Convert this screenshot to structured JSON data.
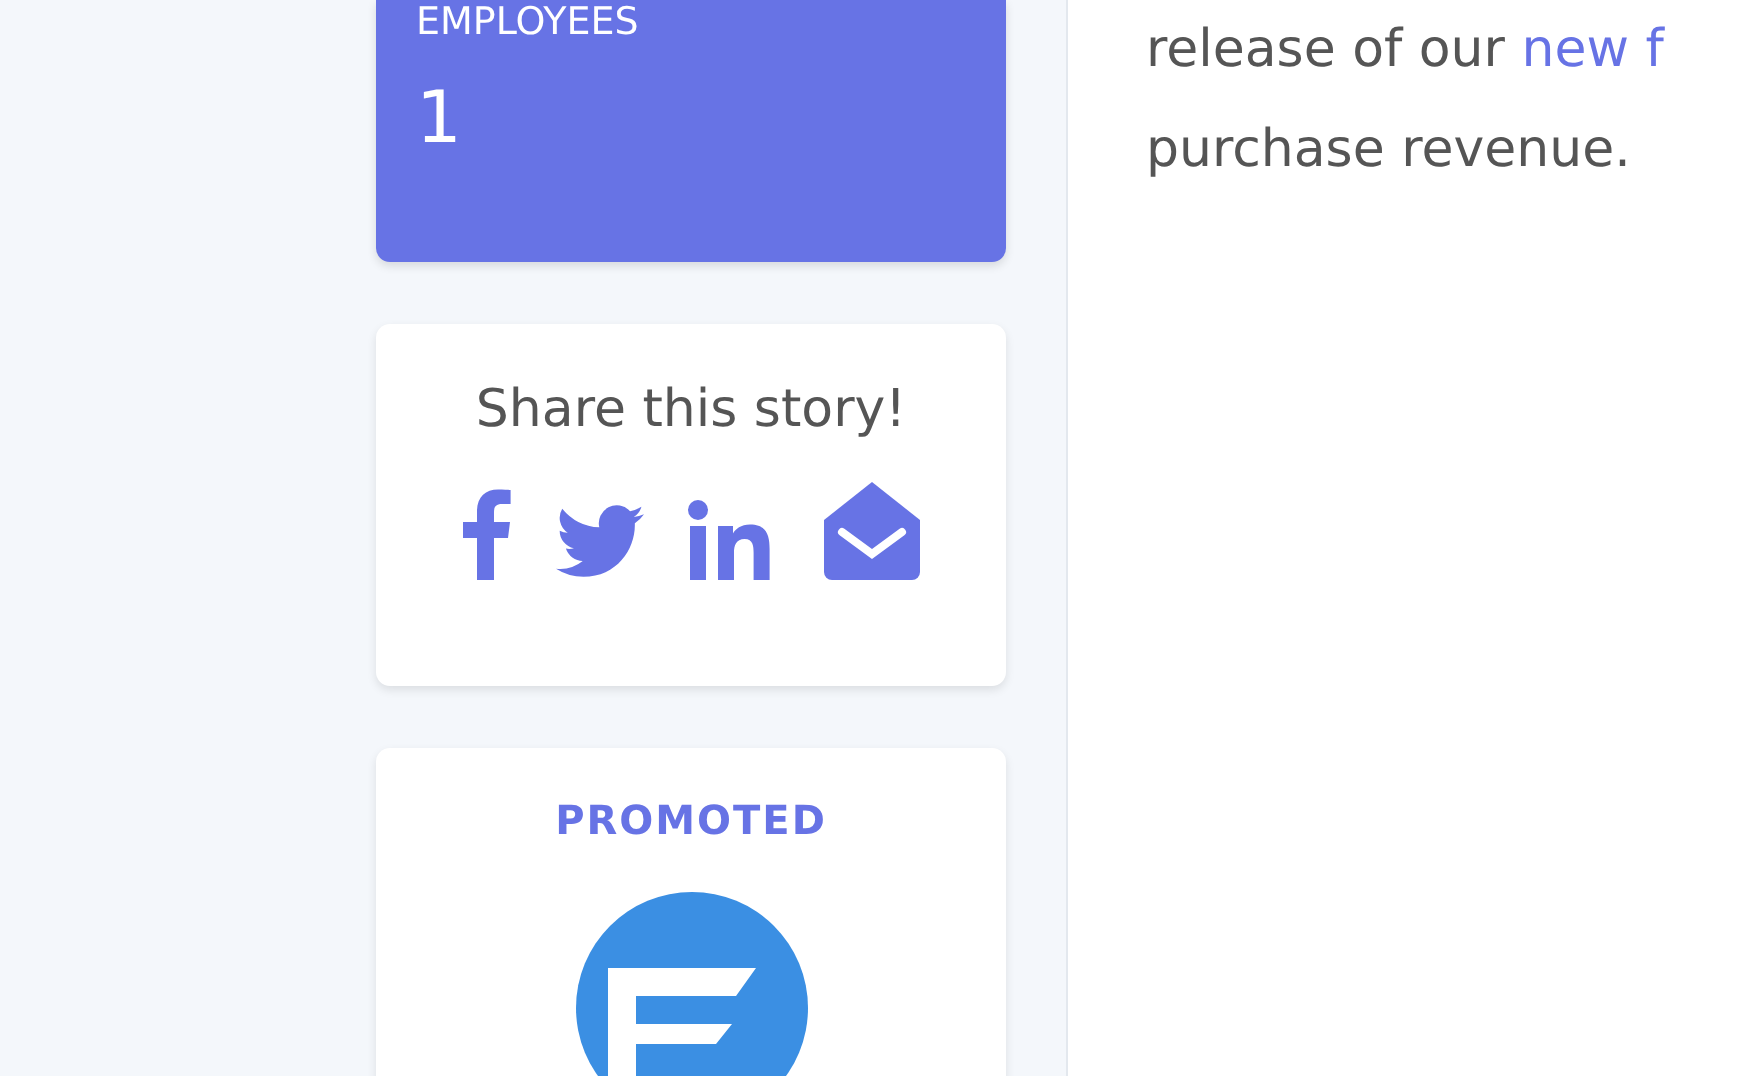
{
  "stat_card": {
    "label": "EMPLOYEES",
    "value": "1"
  },
  "share_card": {
    "title": "Share this story!",
    "icons": [
      {
        "kind": "facebook"
      },
      {
        "kind": "twitter"
      },
      {
        "kind": "linkedin"
      },
      {
        "kind": "email"
      }
    ]
  },
  "promoted_card": {
    "label": "PROMOTED"
  },
  "article": {
    "line_1": "release of our ",
    "link": "new f",
    "line_2": "purchase revenue."
  }
}
